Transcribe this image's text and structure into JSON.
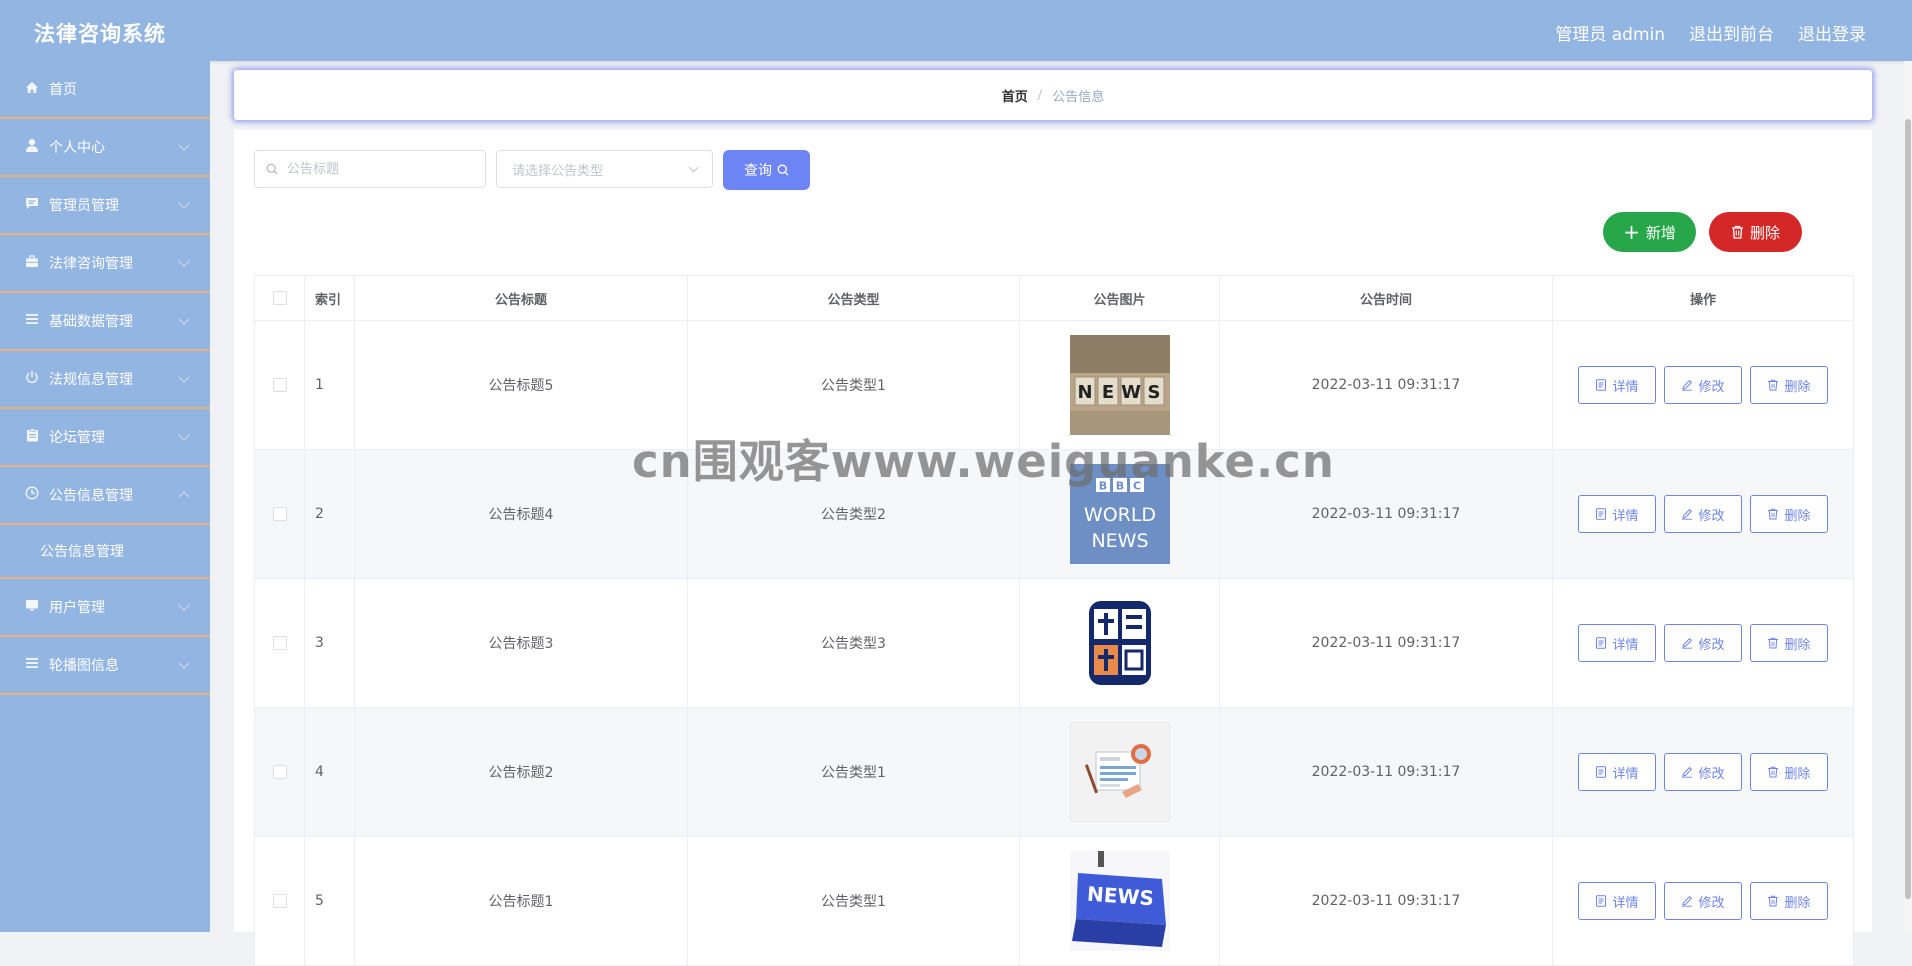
{
  "header": {
    "title": "法律咨询系统",
    "user_label": "管理员 admin",
    "link_front": "退出到前台",
    "link_logout": "退出登录"
  },
  "sidebar": {
    "items": [
      {
        "label": "首页",
        "icon": "home-icon"
      },
      {
        "label": "个人中心",
        "icon": "user-icon"
      },
      {
        "label": "管理员管理",
        "icon": "message-icon"
      },
      {
        "label": "法律咨询管理",
        "icon": "briefcase-icon"
      },
      {
        "label": "基础数据管理",
        "icon": "list-icon"
      },
      {
        "label": "法规信息管理",
        "icon": "power-icon"
      },
      {
        "label": "论坛管理",
        "icon": "clipboard-icon"
      },
      {
        "label": "公告信息管理",
        "icon": "clock-icon"
      },
      {
        "label": "用户管理",
        "icon": "monitor-icon"
      },
      {
        "label": "轮播图信息",
        "icon": "list-icon"
      }
    ],
    "submenu": {
      "label": "公告信息管理"
    }
  },
  "breadcrumb": {
    "home": "首页",
    "separator": "/",
    "current": "公告信息"
  },
  "search": {
    "title_placeholder": "公告标题",
    "type_placeholder": "请选择公告类型",
    "query_label": "查询"
  },
  "actions": {
    "add_label": "新增",
    "delete_label": "删除"
  },
  "table": {
    "headers": [
      "索引",
      "公告标题",
      "公告类型",
      "公告图片",
      "公告时间",
      "操作"
    ],
    "rows": [
      {
        "index": "1",
        "title": "公告标题5",
        "type": "公告类型1",
        "image": "news-blocks",
        "time": "2022-03-11 09:31:17"
      },
      {
        "index": "2",
        "title": "公告标题4",
        "type": "公告类型2",
        "image": "bbc-world-news",
        "time": "2022-03-11 09:31:17"
      },
      {
        "index": "3",
        "title": "公告标题3",
        "type": "公告类型3",
        "image": "cctv-news",
        "time": "2022-03-11 09:31:17"
      },
      {
        "index": "4",
        "title": "公告标题2",
        "type": "公告类型1",
        "image": "newspaper-illustration",
        "time": "2022-03-11 09:31:17"
      },
      {
        "index": "5",
        "title": "公告标题1",
        "type": "公告类型1",
        "image": "news-keyboard",
        "time": "2022-03-11 09:31:17"
      }
    ],
    "row_actions": {
      "detail": "详情",
      "edit": "修改",
      "delete": "删除"
    }
  },
  "watermark": "cn围观客www.weiguanke.cn",
  "colors": {
    "sidebar_bg": "#93b5e2",
    "primary": "#6c84f4",
    "success": "#27a749",
    "danger": "#d42727",
    "menu_divider": "#e5b27e"
  }
}
